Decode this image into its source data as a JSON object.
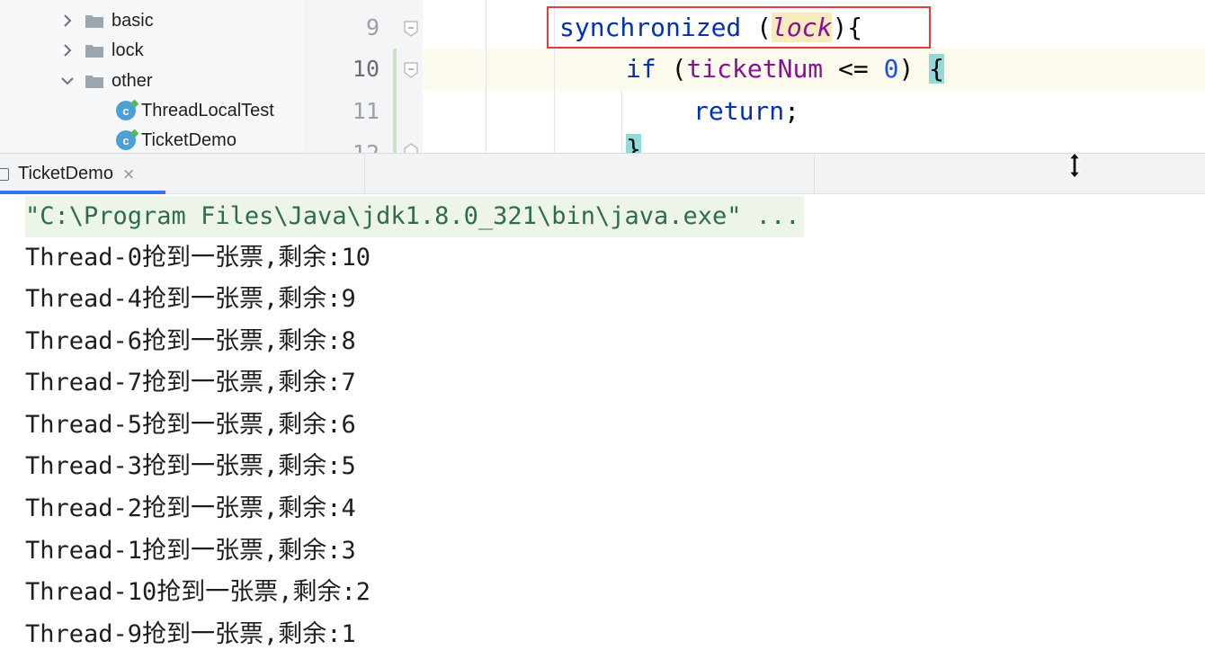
{
  "project_tree": {
    "items": [
      {
        "label": "basic",
        "kind": "folder",
        "expanded": false
      },
      {
        "label": "lock",
        "kind": "folder",
        "expanded": false
      },
      {
        "label": "other",
        "kind": "folder",
        "expanded": true
      },
      {
        "label": "ThreadLocalTest",
        "kind": "class"
      },
      {
        "label": "TicketDemo",
        "kind": "class"
      }
    ]
  },
  "editor": {
    "line_numbers": [
      "9",
      "10",
      "11",
      "12"
    ],
    "lines": {
      "l9": {
        "kw": "synchronized",
        "open": " (",
        "var": "lock",
        "close": "){"
      },
      "l10": {
        "kw": "if",
        "open": " (",
        "var": "ticketNum",
        "op": " <= ",
        "num": "0",
        "close": ") ",
        "brace": "{"
      },
      "l11": {
        "kw": "return",
        "end": ";"
      },
      "l12": {
        "text": "}"
      }
    },
    "highlight_color": "#e03d3d"
  },
  "run_panel": {
    "tab_label": "TicketDemo",
    "close_glyph": "×",
    "command": "\"C:\\Program Files\\Java\\jdk1.8.0_321\\bin\\java.exe\" ...",
    "output": [
      "Thread-0抢到一张票,剩余:10",
      "Thread-4抢到一张票,剩余:9",
      "Thread-6抢到一张票,剩余:8",
      "Thread-7抢到一张票,剩余:7",
      "Thread-5抢到一张票,剩余:6",
      "Thread-3抢到一张票,剩余:5",
      "Thread-2抢到一张票,剩余:4",
      "Thread-1抢到一张票,剩余:3",
      "Thread-10抢到一张票,剩余:2",
      "Thread-9抢到一张票,剩余:1"
    ],
    "accent_color": "#3574f0"
  }
}
